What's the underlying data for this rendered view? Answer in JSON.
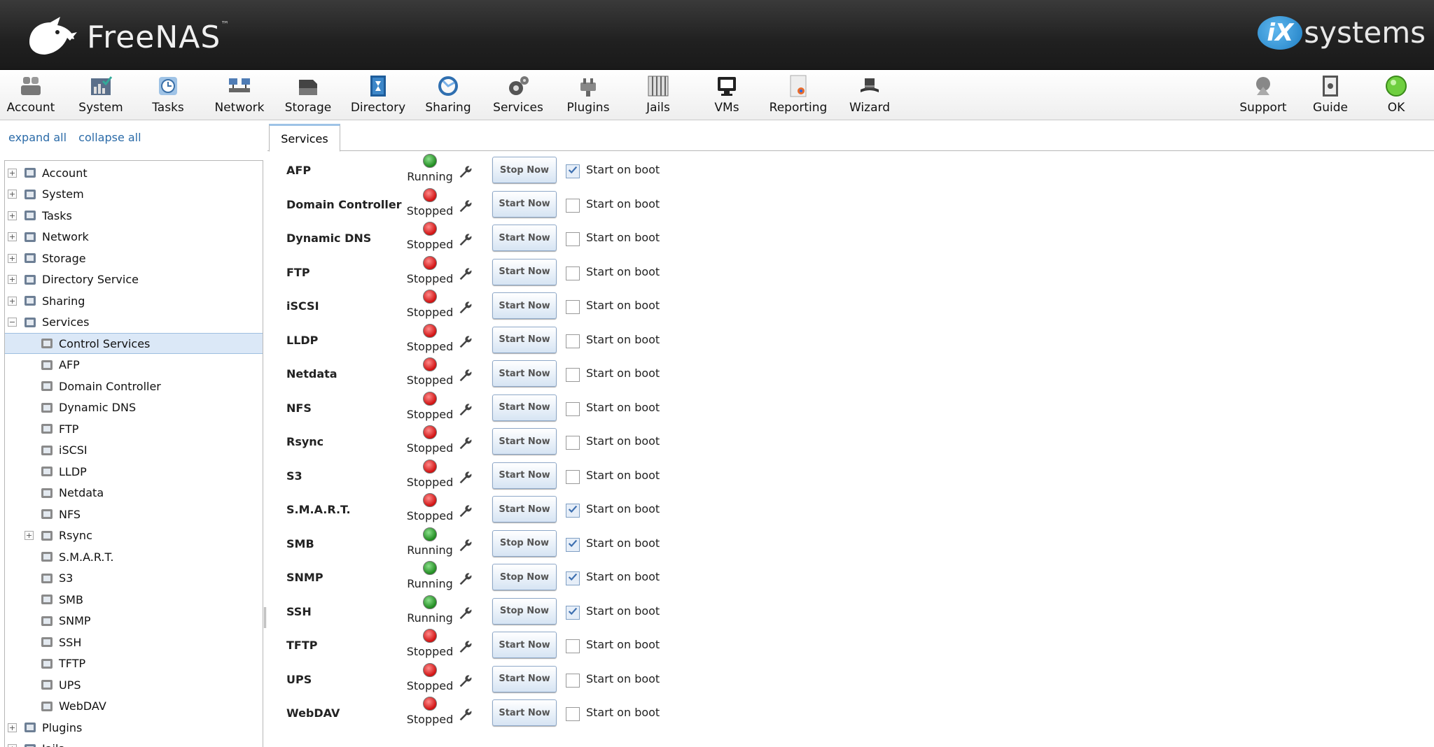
{
  "header": {
    "brand": "FreeNAS",
    "trademark": "™",
    "vendor_mark": "iX",
    "vendor_text": "systems"
  },
  "toolbar": [
    {
      "label": "Account",
      "icon": "account-icon"
    },
    {
      "label": "System",
      "icon": "system-icon"
    },
    {
      "label": "Tasks",
      "icon": "tasks-icon"
    },
    {
      "label": "Network",
      "icon": "network-icon"
    },
    {
      "label": "Storage",
      "icon": "storage-icon"
    },
    {
      "label": "Directory",
      "icon": "directory-icon"
    },
    {
      "label": "Sharing",
      "icon": "sharing-icon"
    },
    {
      "label": "Services",
      "icon": "services-icon"
    },
    {
      "label": "Plugins",
      "icon": "plugins-icon"
    },
    {
      "label": "Jails",
      "icon": "jails-icon"
    },
    {
      "label": "VMs",
      "icon": "vms-icon"
    },
    {
      "label": "Reporting",
      "icon": "reporting-icon"
    },
    {
      "label": "Wizard",
      "icon": "wizard-icon"
    },
    {
      "label": "Support",
      "icon": "support-icon"
    },
    {
      "label": "Guide",
      "icon": "guide-icon"
    },
    {
      "label": "OK",
      "icon": "ok-icon"
    }
  ],
  "tree_links": {
    "expand": "expand all",
    "collapse": "collapse all"
  },
  "tree": [
    {
      "label": "Account",
      "level": 0,
      "expander": "+"
    },
    {
      "label": "System",
      "level": 0,
      "expander": "+"
    },
    {
      "label": "Tasks",
      "level": 0,
      "expander": "+"
    },
    {
      "label": "Network",
      "level": 0,
      "expander": "+"
    },
    {
      "label": "Storage",
      "level": 0,
      "expander": "+"
    },
    {
      "label": "Directory Service",
      "level": 0,
      "expander": "+"
    },
    {
      "label": "Sharing",
      "level": 0,
      "expander": "+"
    },
    {
      "label": "Services",
      "level": 0,
      "expander": "−"
    },
    {
      "label": "Control Services",
      "level": 1,
      "expander": "",
      "selected": true
    },
    {
      "label": "AFP",
      "level": 1,
      "expander": ""
    },
    {
      "label": "Domain Controller",
      "level": 1,
      "expander": ""
    },
    {
      "label": "Dynamic DNS",
      "level": 1,
      "expander": ""
    },
    {
      "label": "FTP",
      "level": 1,
      "expander": ""
    },
    {
      "label": "iSCSI",
      "level": 1,
      "expander": ""
    },
    {
      "label": "LLDP",
      "level": 1,
      "expander": ""
    },
    {
      "label": "Netdata",
      "level": 1,
      "expander": ""
    },
    {
      "label": "NFS",
      "level": 1,
      "expander": ""
    },
    {
      "label": "Rsync",
      "level": 1,
      "expander": "+"
    },
    {
      "label": "S.M.A.R.T.",
      "level": 1,
      "expander": ""
    },
    {
      "label": "S3",
      "level": 1,
      "expander": ""
    },
    {
      "label": "SMB",
      "level": 1,
      "expander": ""
    },
    {
      "label": "SNMP",
      "level": 1,
      "expander": ""
    },
    {
      "label": "SSH",
      "level": 1,
      "expander": ""
    },
    {
      "label": "TFTP",
      "level": 1,
      "expander": ""
    },
    {
      "label": "UPS",
      "level": 1,
      "expander": ""
    },
    {
      "label": "WebDAV",
      "level": 1,
      "expander": ""
    },
    {
      "label": "Plugins",
      "level": 0,
      "expander": "+"
    },
    {
      "label": "Jails",
      "level": 0,
      "expander": "+"
    }
  ],
  "tab": {
    "label": "Services"
  },
  "boot_label": "Start on boot",
  "services": [
    {
      "name": "AFP",
      "status": "Running",
      "button": "Stop Now",
      "boot": true
    },
    {
      "name": "Domain Controller",
      "status": "Stopped",
      "button": "Start Now",
      "boot": false
    },
    {
      "name": "Dynamic DNS",
      "status": "Stopped",
      "button": "Start Now",
      "boot": false
    },
    {
      "name": "FTP",
      "status": "Stopped",
      "button": "Start Now",
      "boot": false
    },
    {
      "name": "iSCSI",
      "status": "Stopped",
      "button": "Start Now",
      "boot": false
    },
    {
      "name": "LLDP",
      "status": "Stopped",
      "button": "Start Now",
      "boot": false
    },
    {
      "name": "Netdata",
      "status": "Stopped",
      "button": "Start Now",
      "boot": false
    },
    {
      "name": "NFS",
      "status": "Stopped",
      "button": "Start Now",
      "boot": false
    },
    {
      "name": "Rsync",
      "status": "Stopped",
      "button": "Start Now",
      "boot": false
    },
    {
      "name": "S3",
      "status": "Stopped",
      "button": "Start Now",
      "boot": false
    },
    {
      "name": "S.M.A.R.T.",
      "status": "Stopped",
      "button": "Start Now",
      "boot": true
    },
    {
      "name": "SMB",
      "status": "Running",
      "button": "Stop Now",
      "boot": true
    },
    {
      "name": "SNMP",
      "status": "Running",
      "button": "Stop Now",
      "boot": true
    },
    {
      "name": "SSH",
      "status": "Running",
      "button": "Stop Now",
      "boot": true
    },
    {
      "name": "TFTP",
      "status": "Stopped",
      "button": "Start Now",
      "boot": false
    },
    {
      "name": "UPS",
      "status": "Stopped",
      "button": "Start Now",
      "boot": false
    },
    {
      "name": "WebDAV",
      "status": "Stopped",
      "button": "Start Now",
      "boot": false
    }
  ],
  "colors": {
    "running": "#2e9b2e",
    "stopped": "#d01010",
    "accent": "#2b6ba8"
  }
}
